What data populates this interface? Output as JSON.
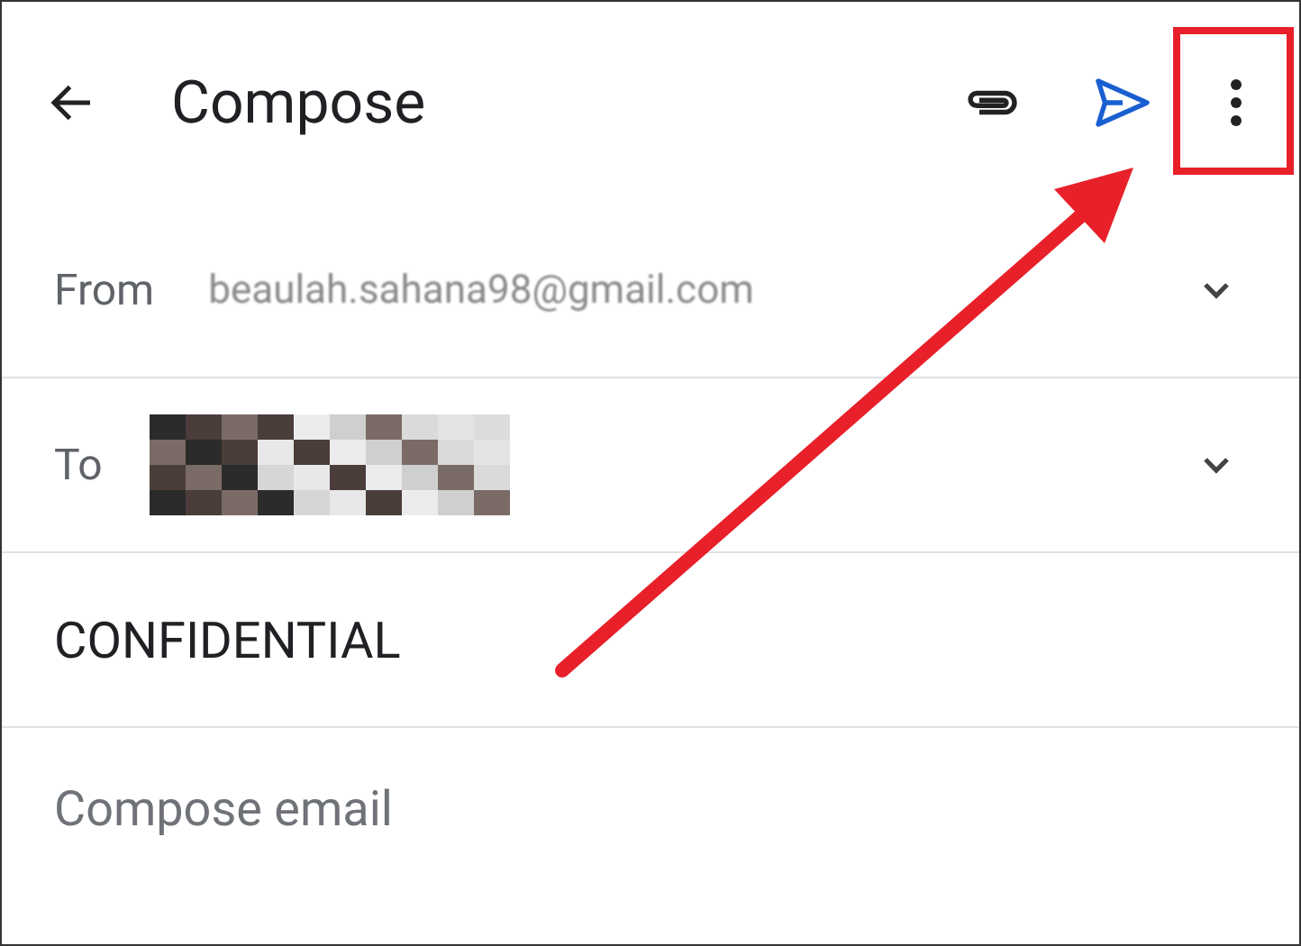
{
  "app_bar": {
    "title": "Compose"
  },
  "from": {
    "label": "From",
    "value": "beaulah.sahana98@gmail.com"
  },
  "to": {
    "label": "To"
  },
  "subject": {
    "value": "CONFIDENTIAL"
  },
  "body": {
    "placeholder": "Compose email"
  },
  "annotations": {
    "highlight_box": true,
    "arrow": true
  }
}
